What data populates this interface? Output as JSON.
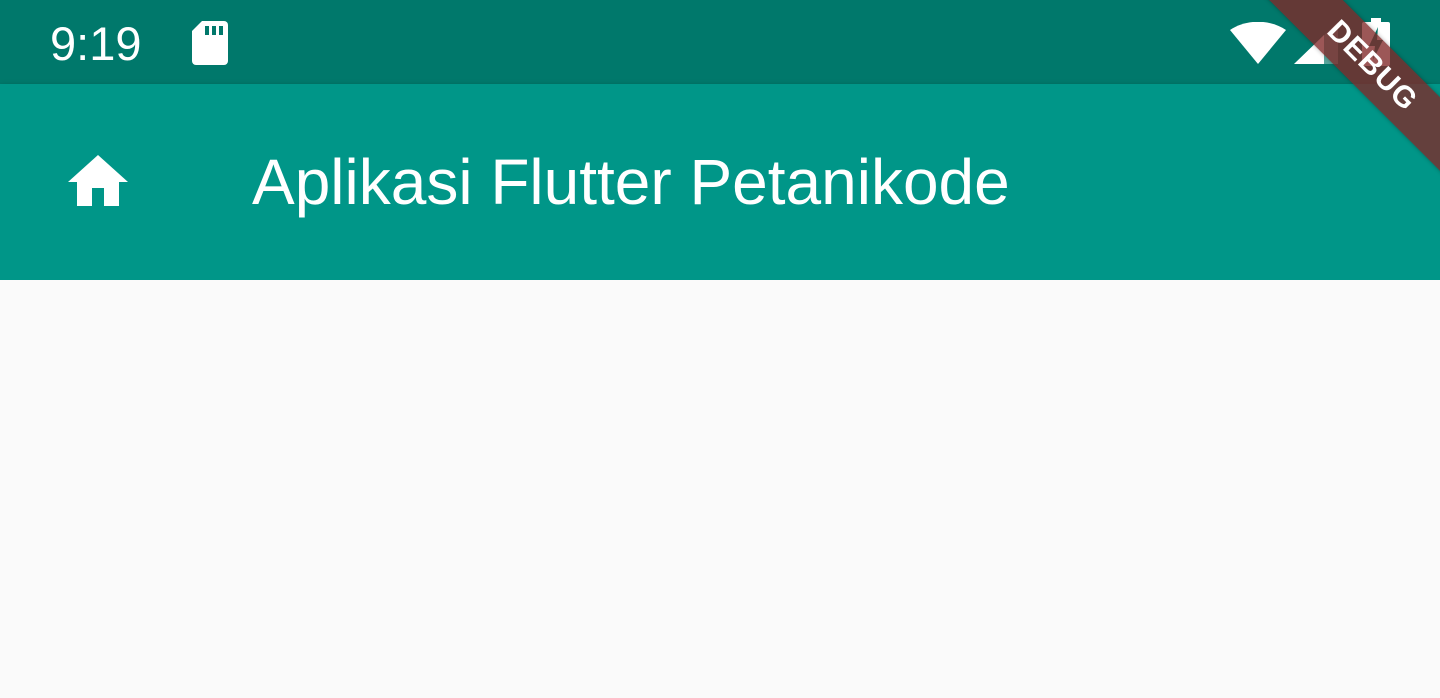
{
  "status_bar": {
    "time": "9:19",
    "icons": [
      "sd-card-icon",
      "wifi-icon",
      "cell-signal-icon",
      "battery-charging-icon"
    ],
    "background_color": "#00786b"
  },
  "app_bar": {
    "leading_icon": "home-icon",
    "title": "Aplikasi Flutter Petanikode",
    "background_color": "#009688",
    "foreground_color": "#ffffff"
  },
  "content": {
    "background_color": "#fafafa"
  },
  "debug_banner": {
    "label": "DEBUG",
    "color": "#7a2a2a"
  }
}
